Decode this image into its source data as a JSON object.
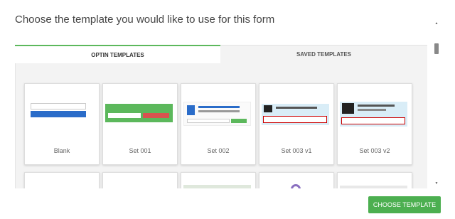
{
  "title": "Choose the template you would like to use for this form",
  "tabs": [
    {
      "label": "OPTIN TEMPLATES"
    },
    {
      "label": "SAVED TEMPLATES"
    }
  ],
  "templates": [
    {
      "label": "Blank"
    },
    {
      "label": "Set 001"
    },
    {
      "label": "Set 002"
    },
    {
      "label": "Set 003 v1"
    },
    {
      "label": "Set 003 v2"
    }
  ],
  "choose_button": "CHOOSE TEMPLATE",
  "colors": {
    "accent": "#4caf50",
    "tab_border": "#5cb85c"
  }
}
